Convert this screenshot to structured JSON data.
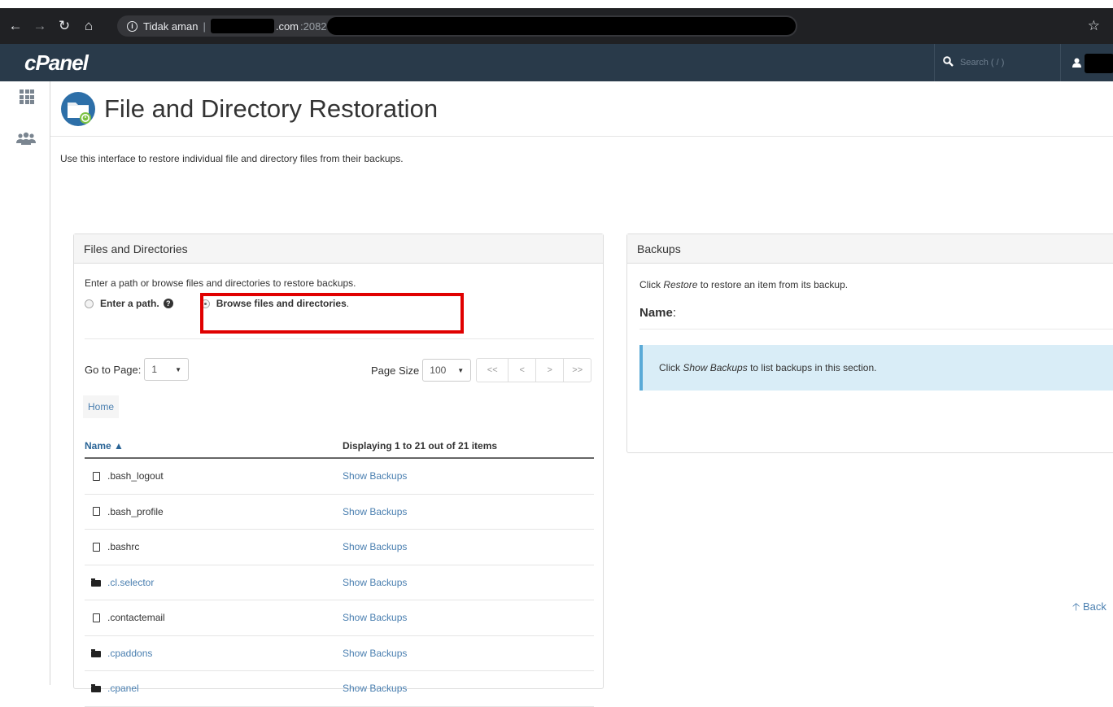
{
  "browser": {
    "security_label": "Tidak aman",
    "host_suffix": ".com",
    "port": ":2082"
  },
  "header": {
    "logo": "cPanel",
    "search_placeholder": "Search ( / )"
  },
  "page": {
    "title": "File and Directory Restoration",
    "description": "Use this interface to restore individual file and directory files from their backups."
  },
  "files_panel": {
    "title": "Files and Directories",
    "intro": "Enter a path or browse files and directories to restore backups.",
    "option_path": "Enter a path.",
    "option_browse": "Browse files and directories",
    "option_browse_period": ".",
    "go_to_page_label": "Go to Page:",
    "go_to_page_value": "1",
    "page_size_label": "Page Size",
    "page_size_value": "100",
    "pager": [
      "<<",
      "<",
      ">",
      ">>"
    ],
    "breadcrumb": "Home",
    "col_name": "Name ▲",
    "col_display": "Displaying 1 to 21 out of 21 items",
    "rows": [
      {
        "name": ".bash_logout",
        "type": "file",
        "action": "Show Backups"
      },
      {
        "name": ".bash_profile",
        "type": "file",
        "action": "Show Backups"
      },
      {
        "name": ".bashrc",
        "type": "file",
        "action": "Show Backups"
      },
      {
        "name": ".cl.selector",
        "type": "folder",
        "action": "Show Backups"
      },
      {
        "name": ".contactemail",
        "type": "file",
        "action": "Show Backups"
      },
      {
        "name": ".cpaddons",
        "type": "folder",
        "action": "Show Backups"
      },
      {
        "name": ".cpanel",
        "type": "folder",
        "action": "Show Backups"
      }
    ]
  },
  "backups_panel": {
    "title": "Backups",
    "intro_pre": "Click ",
    "intro_em": "Restore",
    "intro_post": " to restore an item from its backup.",
    "name_label": "Name",
    "name_colon": ":",
    "info_pre": "Click ",
    "info_em": "Show Backups",
    "info_post": " to list backups in this section."
  },
  "back_link": "Back",
  "colors": {
    "header_bg": "#293a4a",
    "link": "#4a7fb0",
    "highlight": "#e00000",
    "info_bg": "#d9edf7"
  }
}
